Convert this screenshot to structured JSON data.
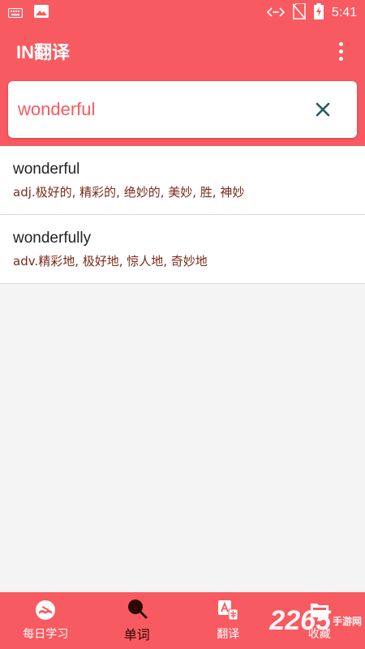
{
  "status_bar": {
    "time": "5:41",
    "icons": [
      "keyboard-icon",
      "image-icon",
      "data-arrows-icon",
      "no-sim-icon",
      "battery-charging-icon"
    ]
  },
  "app_bar": {
    "title": "IN翻译",
    "menu_icon": "more-vert-icon"
  },
  "search": {
    "value": "wonderful",
    "clear_icon": "close-icon"
  },
  "results": [
    {
      "word": "wonderful",
      "definition": "adj.极好的, 精彩的, 绝妙的, 美妙, 胜, 神妙"
    },
    {
      "word": "wonderfully",
      "definition": "adv.精彩地, 极好地, 惊人地, 奇妙地"
    }
  ],
  "bottom_nav": {
    "items": [
      {
        "label": "每日学习",
        "icon": "book-icon",
        "active": false
      },
      {
        "label": "单词",
        "icon": "search-icon",
        "active": true
      },
      {
        "label": "翻译",
        "icon": "translate-icon",
        "active": false
      },
      {
        "label": "收藏",
        "icon": "favorites-folder-icon",
        "active": false
      }
    ]
  },
  "watermark": {
    "number": "2265",
    "text": "手游网"
  },
  "colors": {
    "primary": "#f75a60",
    "definition_text": "#7a2a1a",
    "active_nav": "#2b0a05"
  }
}
